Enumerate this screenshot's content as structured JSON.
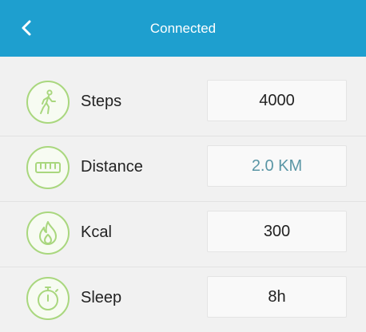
{
  "header": {
    "title": "Connected",
    "back_icon": "chevron-left-icon",
    "background": "#1e9fcf"
  },
  "metrics": [
    {
      "label": "Steps",
      "value": "4000",
      "icon": "walking-person-icon"
    },
    {
      "label": "Distance",
      "value": "2.0 KM",
      "icon": "ruler-icon"
    },
    {
      "label": "Kcal",
      "value": "300",
      "icon": "flame-icon"
    },
    {
      "label": "Sleep",
      "value": "8h",
      "icon": "stopwatch-icon"
    }
  ],
  "colors": {
    "icon_green": "#a9d77e",
    "distance_value": "#5a96a5"
  }
}
